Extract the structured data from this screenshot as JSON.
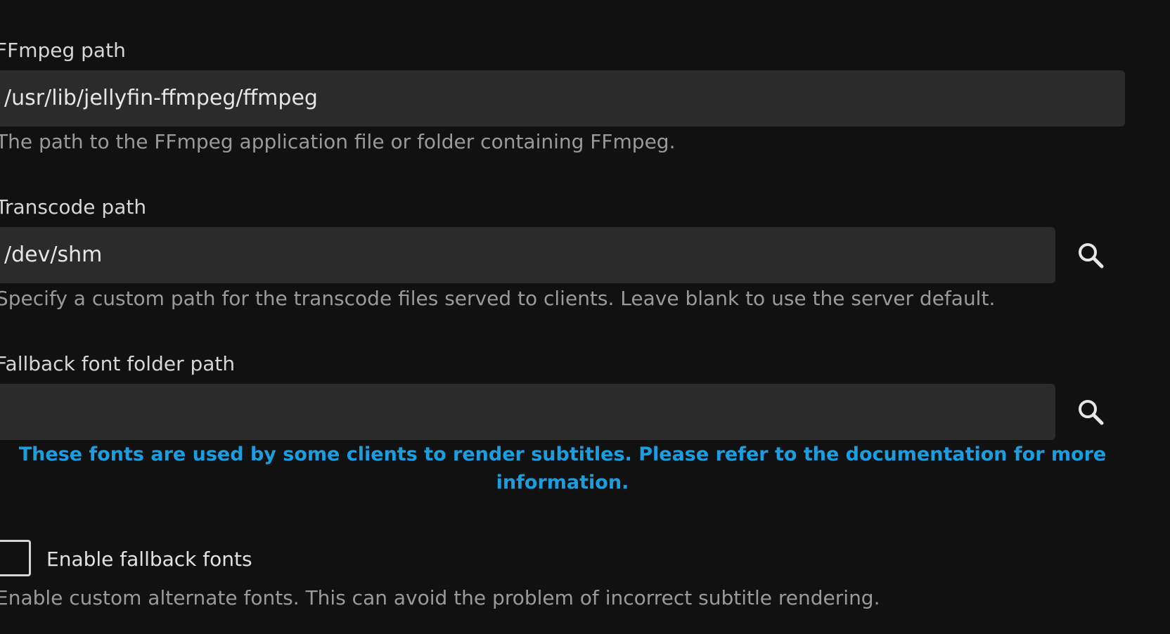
{
  "ffmpeg": {
    "label": "FFmpeg path",
    "value": "/usr/lib/jellyfin-ffmpeg/ffmpeg",
    "helper": "The path to the FFmpeg application file or folder containing FFmpeg."
  },
  "transcode": {
    "label": "Transcode path",
    "value": "/dev/shm",
    "helper": "Specify a custom path for the transcode files served to clients. Leave blank to use the server default.",
    "search_icon": "search-icon"
  },
  "fallback_font": {
    "label": "Fallback font folder path",
    "value": "",
    "info": "These fonts are used by some clients to render subtitles. Please refer to the documentation for more information.",
    "search_icon": "search-icon"
  },
  "enable_fallback": {
    "label": "Enable fallback fonts",
    "checked": false,
    "helper": "Enable custom alternate fonts. This can avoid the problem of incorrect subtitle rendering."
  },
  "colors": {
    "background": "#111111",
    "input_background": "#2b2b2b",
    "info_text": "#1a9ee0",
    "helper_text": "#9a9a9a"
  }
}
